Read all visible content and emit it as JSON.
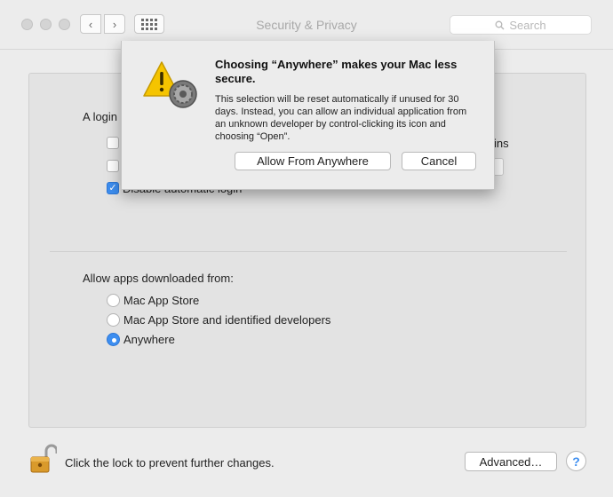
{
  "window": {
    "title": "Security & Privacy",
    "nav": {
      "back_icon": "chevron-left-icon",
      "forward_icon": "chevron-right-icon",
      "grid_icon": "show-all-grid-icon"
    },
    "search": {
      "placeholder": "Search",
      "icon": "search-icon"
    }
  },
  "general": {
    "login_label_fragment": "A login",
    "checkbox_1": {
      "checked": false
    },
    "checkbox_2": {
      "checked": false
    },
    "right_fragment": "ins",
    "checkbox_3": {
      "label": "Disable automatic login",
      "checked": true
    }
  },
  "apps": {
    "label": "Allow apps downloaded from:",
    "options": [
      {
        "label": "Mac App Store",
        "selected": false
      },
      {
        "label": "Mac App Store and identified developers",
        "selected": false
      },
      {
        "label": "Anywhere",
        "selected": true
      }
    ]
  },
  "footer": {
    "lock_text": "Click the lock to prevent further changes.",
    "lock_icon": "open-padlock-icon",
    "advanced_label": "Advanced…",
    "help_label": "?"
  },
  "dialog": {
    "icon": "warning-triangle-icon",
    "title": "Choosing “Anywhere” makes your Mac less secure.",
    "body": "This selection will be reset automatically if unused for 30 days. Instead, you can allow an individual application from an unknown developer by control-clicking its icon and choosing “Open”.",
    "allow_label": "Allow From Anywhere",
    "cancel_label": "Cancel"
  },
  "colors": {
    "accent": "#3d8ef0",
    "warning": "#f5c400"
  }
}
